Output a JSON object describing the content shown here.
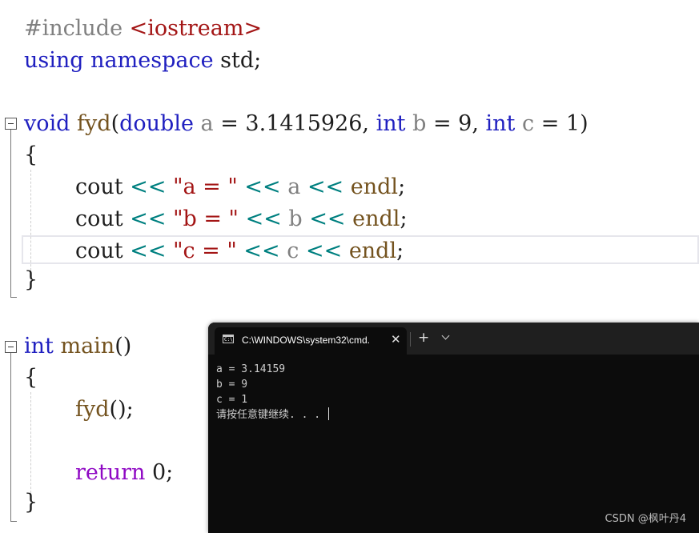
{
  "editor": {
    "lines": {
      "include": {
        "directive": "#include",
        "header": "<iostream>"
      },
      "using": {
        "kw1": "using",
        "kw2": "namespace",
        "name": "std;"
      },
      "fyd_sig": {
        "ret": "void",
        "name": "fyd",
        "open": "(",
        "t1": "double",
        "p1": "a",
        "eq1": " = 3.1415926, ",
        "t2": "int",
        "p2": "b",
        "eq2": " = 9, ",
        "t3": "int",
        "p3": "c",
        "eq3": " = 1)"
      },
      "open_brace_1": "{",
      "cout_a": {
        "cout": "cout",
        "op1": "<<",
        "str": "\"a = \"",
        "op2": "<<",
        "var": "a",
        "op3": "<<",
        "endl": "endl",
        "semi": ";"
      },
      "cout_b": {
        "cout": "cout",
        "op1": "<<",
        "str": "\"b = \"",
        "op2": "<<",
        "var": "b",
        "op3": "<<",
        "endl": "endl",
        "semi": ";"
      },
      "cout_c": {
        "cout": "cout",
        "op1": "<<",
        "str": "\"c = \"",
        "op2": "<<",
        "var": "c",
        "op3": "<<",
        "endl": "endl",
        "semi": ";"
      },
      "close_brace_1": "}",
      "main_sig": {
        "ret": "int",
        "name": "main",
        "parens": "()"
      },
      "open_brace_2": "{",
      "call": {
        "name": "fyd",
        "rest": "();"
      },
      "ret_stmt": {
        "kw": "return",
        "rest": " 0;"
      },
      "close_brace_2": "}"
    }
  },
  "terminal": {
    "tab_title": "C:\\WINDOWS\\system32\\cmd.",
    "tab_icon_text": "C:\\",
    "close_glyph": "✕",
    "new_tab_glyph": "+",
    "output": [
      "a = 3.14159",
      "b = 9",
      "c = 1",
      "请按任意键继续. . . "
    ]
  },
  "watermark": "CSDN @枫叶丹4"
}
